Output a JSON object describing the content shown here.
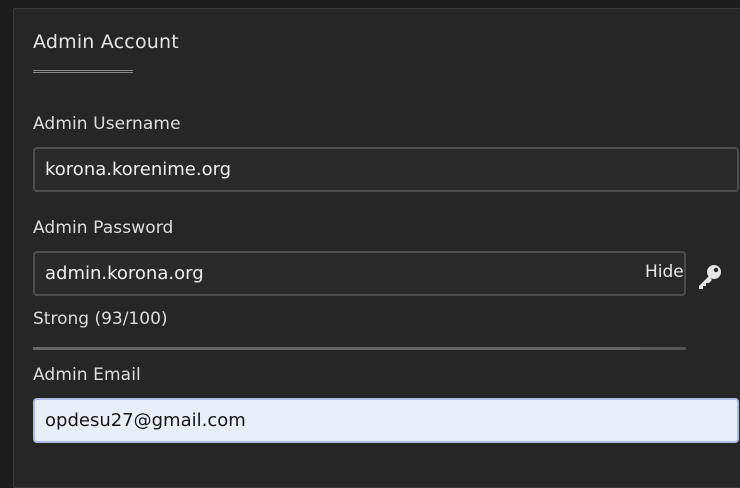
{
  "section": {
    "title": "Admin Account"
  },
  "username": {
    "label": "Admin Username",
    "value": "korona.korenime.org"
  },
  "password": {
    "label": "Admin Password",
    "value": "admin.korona.org",
    "toggle_label": "Hide",
    "strength_text": "Strong (93/100)",
    "strength_fraction": 0.93
  },
  "email": {
    "label": "Admin Email",
    "value": "opdesu27@gmail.com"
  },
  "icons": {
    "generate_password": "key-icon"
  }
}
